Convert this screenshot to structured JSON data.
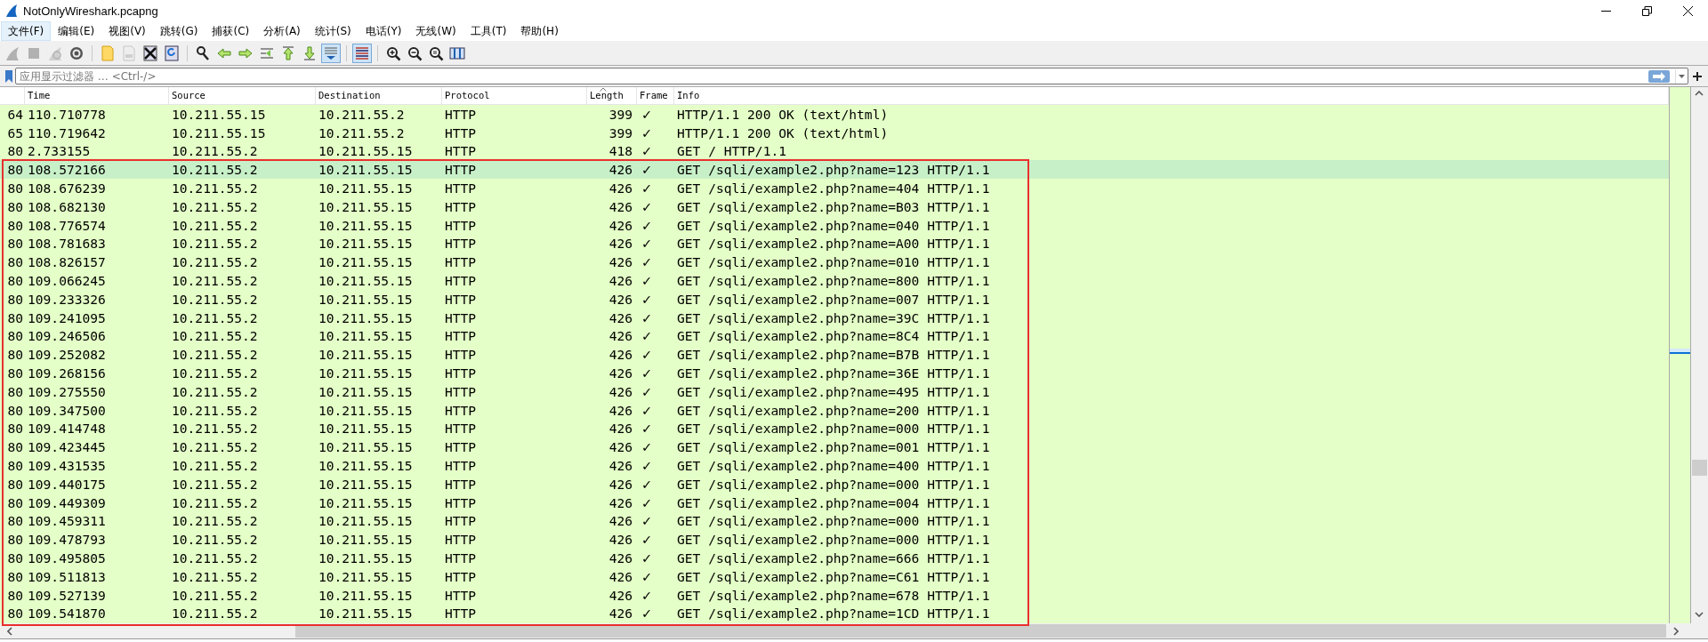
{
  "window": {
    "title": "NotOnlyWireshark.pcapng"
  },
  "menu": [
    {
      "label": "文件(F)",
      "selected": true
    },
    {
      "label": "编辑(E)",
      "selected": false
    },
    {
      "label": "视图(V)",
      "selected": false
    },
    {
      "label": "跳转(G)",
      "selected": false
    },
    {
      "label": "捕获(C)",
      "selected": false
    },
    {
      "label": "分析(A)",
      "selected": false
    },
    {
      "label": "统计(S)",
      "selected": false
    },
    {
      "label": "电话(Y)",
      "selected": false
    },
    {
      "label": "无线(W)",
      "selected": false
    },
    {
      "label": "工具(T)",
      "selected": false
    },
    {
      "label": "帮助(H)",
      "selected": false
    }
  ],
  "toolbar": [
    {
      "kind": "shark",
      "disabled": true,
      "pressed": false
    },
    {
      "kind": "stop",
      "disabled": true,
      "pressed": false
    },
    {
      "kind": "restart",
      "disabled": true,
      "pressed": false
    },
    {
      "kind": "options",
      "disabled": false,
      "pressed": false
    },
    {
      "kind": "sep"
    },
    {
      "kind": "open",
      "disabled": false,
      "pressed": false
    },
    {
      "kind": "save",
      "disabled": true,
      "pressed": false
    },
    {
      "kind": "close",
      "disabled": false,
      "pressed": false
    },
    {
      "kind": "reload",
      "disabled": false,
      "pressed": false
    },
    {
      "kind": "sep"
    },
    {
      "kind": "find",
      "disabled": false,
      "pressed": false
    },
    {
      "kind": "back",
      "disabled": false,
      "pressed": false
    },
    {
      "kind": "forward",
      "disabled": false,
      "pressed": false
    },
    {
      "kind": "goto",
      "disabled": false,
      "pressed": false
    },
    {
      "kind": "first",
      "disabled": false,
      "pressed": false
    },
    {
      "kind": "last",
      "disabled": false,
      "pressed": false
    },
    {
      "kind": "autoscroll",
      "disabled": false,
      "pressed": true
    },
    {
      "kind": "sep"
    },
    {
      "kind": "colorize",
      "disabled": false,
      "pressed": true
    },
    {
      "kind": "sep"
    },
    {
      "kind": "zoomin",
      "disabled": false,
      "pressed": false
    },
    {
      "kind": "zoomout",
      "disabled": false,
      "pressed": false
    },
    {
      "kind": "zoomnormal",
      "disabled": false,
      "pressed": false
    },
    {
      "kind": "resize",
      "disabled": false,
      "pressed": false
    }
  ],
  "filter": {
    "placeholder": "应用显示过滤器 … <Ctrl-/>"
  },
  "table": {
    "columns": [
      {
        "label": "Time",
        "sorted": false
      },
      {
        "label": "Source",
        "sorted": false
      },
      {
        "label": "Destination",
        "sorted": false
      },
      {
        "label": "Protocol",
        "sorted": false
      },
      {
        "label": "Length",
        "sorted": true
      },
      {
        "label": "Frame",
        "sorted": false
      },
      {
        "label": "Info",
        "sorted": false
      }
    ],
    "rows": [
      {
        "no": "64",
        "time": "110.710778",
        "source": "10.211.55.15",
        "destination": "10.211.55.2",
        "protocol": "HTTP",
        "length": "399",
        "frame": "✓",
        "info": "HTTP/1.1 200 OK  (text/html)",
        "selected": false
      },
      {
        "no": "65",
        "time": "110.719642",
        "source": "10.211.55.15",
        "destination": "10.211.55.2",
        "protocol": "HTTP",
        "length": "399",
        "frame": "✓",
        "info": "HTTP/1.1 200 OK  (text/html)",
        "selected": false
      },
      {
        "no": "80",
        "time": "2.733155",
        "source": "10.211.55.2",
        "destination": "10.211.55.15",
        "protocol": "HTTP",
        "length": "418",
        "frame": "✓",
        "info": "GET / HTTP/1.1",
        "selected": false
      },
      {
        "no": "80",
        "time": "108.572166",
        "source": "10.211.55.2",
        "destination": "10.211.55.15",
        "protocol": "HTTP",
        "length": "426",
        "frame": "✓",
        "info": "GET /sqli/example2.php?name=123 HTTP/1.1",
        "selected": true
      },
      {
        "no": "80",
        "time": "108.676239",
        "source": "10.211.55.2",
        "destination": "10.211.55.15",
        "protocol": "HTTP",
        "length": "426",
        "frame": "✓",
        "info": "GET /sqli/example2.php?name=404 HTTP/1.1",
        "selected": false
      },
      {
        "no": "80",
        "time": "108.682130",
        "source": "10.211.55.2",
        "destination": "10.211.55.15",
        "protocol": "HTTP",
        "length": "426",
        "frame": "✓",
        "info": "GET /sqli/example2.php?name=B03 HTTP/1.1",
        "selected": false
      },
      {
        "no": "80",
        "time": "108.776574",
        "source": "10.211.55.2",
        "destination": "10.211.55.15",
        "protocol": "HTTP",
        "length": "426",
        "frame": "✓",
        "info": "GET /sqli/example2.php?name=040 HTTP/1.1",
        "selected": false
      },
      {
        "no": "80",
        "time": "108.781683",
        "source": "10.211.55.2",
        "destination": "10.211.55.15",
        "protocol": "HTTP",
        "length": "426",
        "frame": "✓",
        "info": "GET /sqli/example2.php?name=A00 HTTP/1.1",
        "selected": false
      },
      {
        "no": "80",
        "time": "108.826157",
        "source": "10.211.55.2",
        "destination": "10.211.55.15",
        "protocol": "HTTP",
        "length": "426",
        "frame": "✓",
        "info": "GET /sqli/example2.php?name=010 HTTP/1.1",
        "selected": false
      },
      {
        "no": "80",
        "time": "109.066245",
        "source": "10.211.55.2",
        "destination": "10.211.55.15",
        "protocol": "HTTP",
        "length": "426",
        "frame": "✓",
        "info": "GET /sqli/example2.php?name=800 HTTP/1.1",
        "selected": false
      },
      {
        "no": "80",
        "time": "109.233326",
        "source": "10.211.55.2",
        "destination": "10.211.55.15",
        "protocol": "HTTP",
        "length": "426",
        "frame": "✓",
        "info": "GET /sqli/example2.php?name=007 HTTP/1.1",
        "selected": false
      },
      {
        "no": "80",
        "time": "109.241095",
        "source": "10.211.55.2",
        "destination": "10.211.55.15",
        "protocol": "HTTP",
        "length": "426",
        "frame": "✓",
        "info": "GET /sqli/example2.php?name=39C HTTP/1.1",
        "selected": false
      },
      {
        "no": "80",
        "time": "109.246506",
        "source": "10.211.55.2",
        "destination": "10.211.55.15",
        "protocol": "HTTP",
        "length": "426",
        "frame": "✓",
        "info": "GET /sqli/example2.php?name=8C4 HTTP/1.1",
        "selected": false
      },
      {
        "no": "80",
        "time": "109.252082",
        "source": "10.211.55.2",
        "destination": "10.211.55.15",
        "protocol": "HTTP",
        "length": "426",
        "frame": "✓",
        "info": "GET /sqli/example2.php?name=B7B HTTP/1.1",
        "selected": false
      },
      {
        "no": "80",
        "time": "109.268156",
        "source": "10.211.55.2",
        "destination": "10.211.55.15",
        "protocol": "HTTP",
        "length": "426",
        "frame": "✓",
        "info": "GET /sqli/example2.php?name=36E HTTP/1.1",
        "selected": false
      },
      {
        "no": "80",
        "time": "109.275550",
        "source": "10.211.55.2",
        "destination": "10.211.55.15",
        "protocol": "HTTP",
        "length": "426",
        "frame": "✓",
        "info": "GET /sqli/example2.php?name=495 HTTP/1.1",
        "selected": false
      },
      {
        "no": "80",
        "time": "109.347500",
        "source": "10.211.55.2",
        "destination": "10.211.55.15",
        "protocol": "HTTP",
        "length": "426",
        "frame": "✓",
        "info": "GET /sqli/example2.php?name=200 HTTP/1.1",
        "selected": false
      },
      {
        "no": "80",
        "time": "109.414748",
        "source": "10.211.55.2",
        "destination": "10.211.55.15",
        "protocol": "HTTP",
        "length": "426",
        "frame": "✓",
        "info": "GET /sqli/example2.php?name=000 HTTP/1.1",
        "selected": false
      },
      {
        "no": "80",
        "time": "109.423445",
        "source": "10.211.55.2",
        "destination": "10.211.55.15",
        "protocol": "HTTP",
        "length": "426",
        "frame": "✓",
        "info": "GET /sqli/example2.php?name=001 HTTP/1.1",
        "selected": false
      },
      {
        "no": "80",
        "time": "109.431535",
        "source": "10.211.55.2",
        "destination": "10.211.55.15",
        "protocol": "HTTP",
        "length": "426",
        "frame": "✓",
        "info": "GET /sqli/example2.php?name=400 HTTP/1.1",
        "selected": false
      },
      {
        "no": "80",
        "time": "109.440175",
        "source": "10.211.55.2",
        "destination": "10.211.55.15",
        "protocol": "HTTP",
        "length": "426",
        "frame": "✓",
        "info": "GET /sqli/example2.php?name=000 HTTP/1.1",
        "selected": false
      },
      {
        "no": "80",
        "time": "109.449309",
        "source": "10.211.55.2",
        "destination": "10.211.55.15",
        "protocol": "HTTP",
        "length": "426",
        "frame": "✓",
        "info": "GET /sqli/example2.php?name=004 HTTP/1.1",
        "selected": false
      },
      {
        "no": "80",
        "time": "109.459311",
        "source": "10.211.55.2",
        "destination": "10.211.55.15",
        "protocol": "HTTP",
        "length": "426",
        "frame": "✓",
        "info": "GET /sqli/example2.php?name=000 HTTP/1.1",
        "selected": false
      },
      {
        "no": "80",
        "time": "109.478793",
        "source": "10.211.55.2",
        "destination": "10.211.55.15",
        "protocol": "HTTP",
        "length": "426",
        "frame": "✓",
        "info": "GET /sqli/example2.php?name=000 HTTP/1.1",
        "selected": false
      },
      {
        "no": "80",
        "time": "109.495805",
        "source": "10.211.55.2",
        "destination": "10.211.55.15",
        "protocol": "HTTP",
        "length": "426",
        "frame": "✓",
        "info": "GET /sqli/example2.php?name=666 HTTP/1.1",
        "selected": false
      },
      {
        "no": "80",
        "time": "109.511813",
        "source": "10.211.55.2",
        "destination": "10.211.55.15",
        "protocol": "HTTP",
        "length": "426",
        "frame": "✓",
        "info": "GET /sqli/example2.php?name=C61 HTTP/1.1",
        "selected": false
      },
      {
        "no": "80",
        "time": "109.527139",
        "source": "10.211.55.2",
        "destination": "10.211.55.15",
        "protocol": "HTTP",
        "length": "426",
        "frame": "✓",
        "info": "GET /sqli/example2.php?name=678 HTTP/1.1",
        "selected": false
      },
      {
        "no": "80",
        "time": "109.541870",
        "source": "10.211.55.2",
        "destination": "10.211.55.15",
        "protocol": "HTTP",
        "length": "426",
        "frame": "✓",
        "info": "GET /sqli/example2.php?name=1CD HTTP/1.1",
        "selected": false
      }
    ]
  }
}
